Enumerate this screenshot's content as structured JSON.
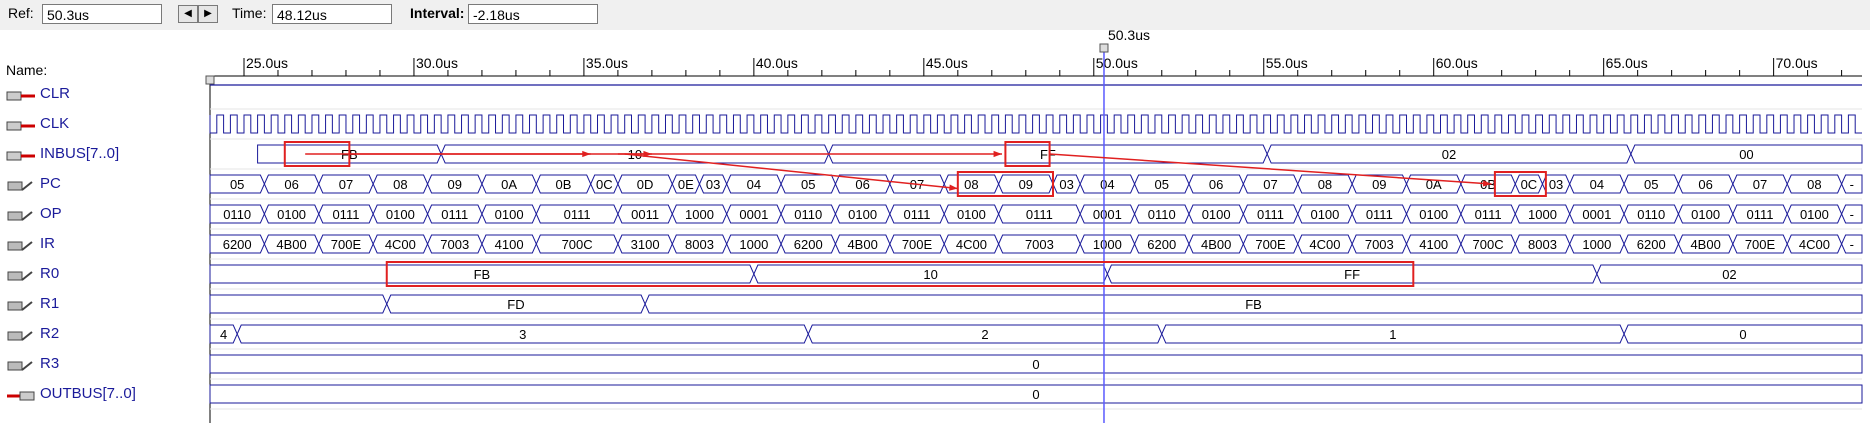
{
  "toolbar": {
    "ref_label": "Ref:",
    "ref_value": "50.3us",
    "time_label": "Time:",
    "time_value": "48.12us",
    "interval_label": "Interval:",
    "interval_value": "-2.18us"
  },
  "cursor": {
    "label": "50.3us",
    "time_us": 50.3
  },
  "timeline": {
    "start_us": 24.0,
    "end_us": 72.6,
    "ticks": [
      "25.0us",
      "30.0us",
      "35.0us",
      "40.0us",
      "45.0us",
      "50.0us",
      "55.0us",
      "60.0us",
      "65.0us",
      "70.0us"
    ],
    "tick_values_us": [
      25,
      30,
      35,
      40,
      45,
      50,
      55,
      60,
      65,
      70
    ]
  },
  "names_header": "Name:",
  "signals": [
    {
      "name": "CLR",
      "icon": "input-pin-icon",
      "type": "level",
      "value": "high"
    },
    {
      "name": "CLK",
      "icon": "input-pin-icon",
      "type": "clock",
      "period_us": 0.4
    },
    {
      "name": "INBUS[7..0]",
      "icon": "input-bus-icon",
      "type": "bus",
      "segments": [
        {
          "t": 25.4,
          "v": "FB"
        },
        {
          "t": 30.8,
          "v": "10"
        },
        {
          "t": 42.2,
          "v": "FF"
        },
        {
          "t": 55.1,
          "v": "02"
        },
        {
          "t": 65.8,
          "v": "00"
        }
      ]
    },
    {
      "name": "PC",
      "icon": "output-bus-icon",
      "type": "bus",
      "segments": [
        {
          "t": 24.0,
          "v": "05"
        },
        {
          "t": 25.6,
          "v": "06"
        },
        {
          "t": 27.2,
          "v": "07"
        },
        {
          "t": 28.8,
          "v": "08"
        },
        {
          "t": 30.4,
          "v": "09"
        },
        {
          "t": 32.0,
          "v": "0A"
        },
        {
          "t": 33.6,
          "v": "0B"
        },
        {
          "t": 35.2,
          "v": "0C"
        },
        {
          "t": 36.0,
          "v": "0D"
        },
        {
          "t": 37.6,
          "v": "0E"
        },
        {
          "t": 38.4,
          "v": "03"
        },
        {
          "t": 39.2,
          "v": "04"
        },
        {
          "t": 40.8,
          "v": "05"
        },
        {
          "t": 42.4,
          "v": "06"
        },
        {
          "t": 44.0,
          "v": "07"
        },
        {
          "t": 45.6,
          "v": "08"
        },
        {
          "t": 47.2,
          "v": "09"
        },
        {
          "t": 48.8,
          "v": "03"
        },
        {
          "t": 49.6,
          "v": "04"
        },
        {
          "t": 51.2,
          "v": "05"
        },
        {
          "t": 52.8,
          "v": "06"
        },
        {
          "t": 54.4,
          "v": "07"
        },
        {
          "t": 56.0,
          "v": "08"
        },
        {
          "t": 57.6,
          "v": "09"
        },
        {
          "t": 59.2,
          "v": "0A"
        },
        {
          "t": 60.8,
          "v": "0B"
        },
        {
          "t": 62.4,
          "v": "0C"
        },
        {
          "t": 63.2,
          "v": "03"
        },
        {
          "t": 64.0,
          "v": "04"
        },
        {
          "t": 65.6,
          "v": "05"
        },
        {
          "t": 67.2,
          "v": "06"
        },
        {
          "t": 68.8,
          "v": "07"
        },
        {
          "t": 70.4,
          "v": "08"
        },
        {
          "t": 72.0,
          "v": "-"
        }
      ]
    },
    {
      "name": "OP",
      "icon": "output-bus-icon",
      "type": "bus",
      "segments": [
        {
          "t": 24.0,
          "v": "0110"
        },
        {
          "t": 25.6,
          "v": "0100"
        },
        {
          "t": 27.2,
          "v": "0111"
        },
        {
          "t": 28.8,
          "v": "0100"
        },
        {
          "t": 30.4,
          "v": "0111"
        },
        {
          "t": 32.0,
          "v": "0100"
        },
        {
          "t": 33.6,
          "v": "0111"
        },
        {
          "t": 36.0,
          "v": "0011"
        },
        {
          "t": 37.6,
          "v": "1000"
        },
        {
          "t": 39.2,
          "v": "0001"
        },
        {
          "t": 40.8,
          "v": "0110"
        },
        {
          "t": 42.4,
          "v": "0100"
        },
        {
          "t": 44.0,
          "v": "0111"
        },
        {
          "t": 45.6,
          "v": "0100"
        },
        {
          "t": 47.2,
          "v": "0111"
        },
        {
          "t": 49.6,
          "v": "0001"
        },
        {
          "t": 51.2,
          "v": "0110"
        },
        {
          "t": 52.8,
          "v": "0100"
        },
        {
          "t": 54.4,
          "v": "0111"
        },
        {
          "t": 56.0,
          "v": "0100"
        },
        {
          "t": 57.6,
          "v": "0111"
        },
        {
          "t": 59.2,
          "v": "0100"
        },
        {
          "t": 60.8,
          "v": "0111"
        },
        {
          "t": 62.4,
          "v": "1000"
        },
        {
          "t": 64.0,
          "v": "0001"
        },
        {
          "t": 65.6,
          "v": "0110"
        },
        {
          "t": 67.2,
          "v": "0100"
        },
        {
          "t": 68.8,
          "v": "0111"
        },
        {
          "t": 70.4,
          "v": "0100"
        },
        {
          "t": 72.0,
          "v": "-"
        }
      ]
    },
    {
      "name": "IR",
      "icon": "output-bus-icon",
      "type": "bus",
      "segments": [
        {
          "t": 24.0,
          "v": "6200"
        },
        {
          "t": 25.6,
          "v": "4B00"
        },
        {
          "t": 27.2,
          "v": "700E"
        },
        {
          "t": 28.8,
          "v": "4C00"
        },
        {
          "t": 30.4,
          "v": "7003"
        },
        {
          "t": 32.0,
          "v": "4100"
        },
        {
          "t": 33.6,
          "v": "700C"
        },
        {
          "t": 36.0,
          "v": "3100"
        },
        {
          "t": 37.6,
          "v": "8003"
        },
        {
          "t": 39.2,
          "v": "1000"
        },
        {
          "t": 40.8,
          "v": "6200"
        },
        {
          "t": 42.4,
          "v": "4B00"
        },
        {
          "t": 44.0,
          "v": "700E"
        },
        {
          "t": 45.6,
          "v": "4C00"
        },
        {
          "t": 47.2,
          "v": "7003"
        },
        {
          "t": 49.6,
          "v": "1000"
        },
        {
          "t": 51.2,
          "v": "6200"
        },
        {
          "t": 52.8,
          "v": "4B00"
        },
        {
          "t": 54.4,
          "v": "700E"
        },
        {
          "t": 56.0,
          "v": "4C00"
        },
        {
          "t": 57.6,
          "v": "7003"
        },
        {
          "t": 59.2,
          "v": "4100"
        },
        {
          "t": 60.8,
          "v": "700C"
        },
        {
          "t": 62.4,
          "v": "8003"
        },
        {
          "t": 64.0,
          "v": "1000"
        },
        {
          "t": 65.6,
          "v": "6200"
        },
        {
          "t": 67.2,
          "v": "4B00"
        },
        {
          "t": 68.8,
          "v": "700E"
        },
        {
          "t": 70.4,
          "v": "4C00"
        },
        {
          "t": 72.0,
          "v": "-"
        }
      ]
    },
    {
      "name": "R0",
      "icon": "output-bus-icon",
      "type": "bus",
      "segments": [
        {
          "t": 24.0,
          "v": "FB"
        },
        {
          "t": 40.0,
          "v": "10"
        },
        {
          "t": 50.4,
          "v": "FF"
        },
        {
          "t": 64.8,
          "v": "02"
        }
      ]
    },
    {
      "name": "R1",
      "icon": "output-bus-icon",
      "type": "bus",
      "segments": [
        {
          "t": 24.0,
          "v": ""
        },
        {
          "t": 29.2,
          "v": "FD"
        },
        {
          "t": 36.8,
          "v": "FB"
        }
      ]
    },
    {
      "name": "R2",
      "icon": "output-bus-icon",
      "type": "bus",
      "segments": [
        {
          "t": 24.0,
          "v": "4"
        },
        {
          "t": 24.8,
          "v": "3"
        },
        {
          "t": 41.6,
          "v": "2"
        },
        {
          "t": 52.0,
          "v": "1"
        },
        {
          "t": 65.6,
          "v": "0"
        }
      ]
    },
    {
      "name": "R3",
      "icon": "output-bus-icon",
      "type": "bus",
      "segments": [
        {
          "t": 24.0,
          "v": "0"
        }
      ]
    },
    {
      "name": "OUTBUS[7..0]",
      "icon": "output-pin-icon",
      "type": "bus",
      "segments": [
        {
          "t": 24.0,
          "v": "0"
        }
      ]
    }
  ],
  "highlights": {
    "color": "#e02020"
  },
  "colors": {
    "wave": "#1a1a9a",
    "cursor": "#5b5bff",
    "grid": "#808080"
  }
}
